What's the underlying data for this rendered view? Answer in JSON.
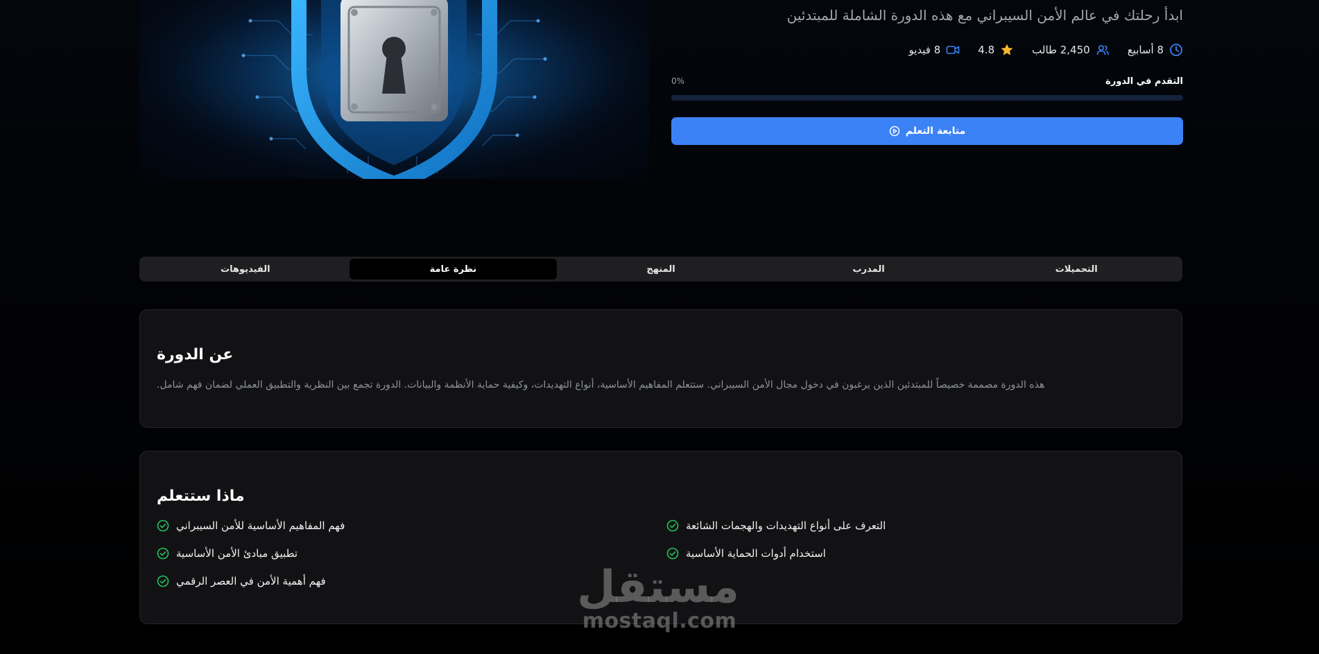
{
  "course": {
    "subtitle": "ابدأ رحلتك في عالم الأمن السيبراني مع هذه الدورة الشاملة للمبتدئين",
    "meta": {
      "duration": "8 أسابيع",
      "students": "2,450 طالب",
      "rating": "4.8",
      "videos": "8 فيديو"
    },
    "progress": {
      "label": "التقدم في الدورة",
      "percent_text": "0%",
      "value": 0
    },
    "continue_label": "متابعة التعلم"
  },
  "tabs": [
    {
      "label": "التحميلات"
    },
    {
      "label": "المدرب"
    },
    {
      "label": "المنهج"
    },
    {
      "label": "نظرة عامة",
      "active": true
    },
    {
      "label": "الفيديوهات"
    }
  ],
  "about": {
    "title": "عن الدورة",
    "text": "هذه الدورة مصممة خصيصاً للمبتدئين الذين يرغبون في دخول مجال الأمن السيبراني. ستتعلم المفاهيم الأساسية، أنواع التهديدات، وكيفية حماية الأنظمة والبيانات. الدورة تجمع بين النظرية والتطبيق العملي لضمان فهم شامل."
  },
  "learn": {
    "title": "ماذا ستتعلم",
    "items": [
      "فهم المفاهيم الأساسية للأمن السيبراني",
      "التعرف على أنواع التهديدات والهجمات الشائعة",
      "تطبيق مبادئ الأمن الأساسية",
      "استخدام أدوات الحماية الأساسية",
      "فهم أهمية الأمن في العصر الرقمي"
    ]
  },
  "watermark": {
    "arabic": "مستقل",
    "latin": "mostaql.com"
  },
  "colors": {
    "accent": "#3b82f6",
    "star": "#f5b82e",
    "check": "#22c55e",
    "card_bg": "#121214"
  },
  "icons": [
    "clock-icon",
    "users-icon",
    "star-icon",
    "video-icon",
    "play-circle-icon",
    "check-circle-icon",
    "padlock-shield-image"
  ]
}
